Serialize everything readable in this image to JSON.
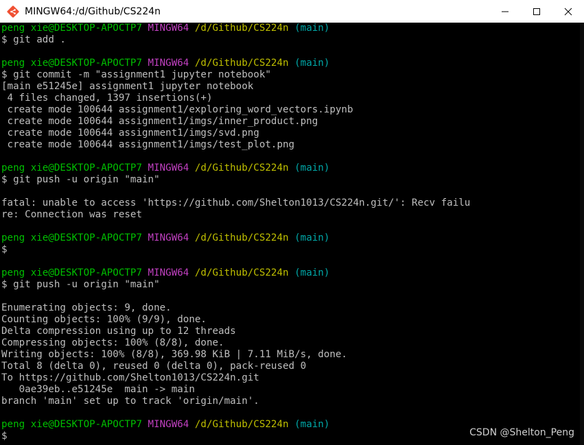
{
  "window": {
    "title": "MINGW64:/d/Github/CS224n",
    "icon": "git-bash-icon",
    "controls": [
      "minimize-icon",
      "maximize-icon",
      "close-icon"
    ]
  },
  "colors": {
    "user": "#00c000",
    "host": "#c040c0",
    "path": "#bfbf00",
    "branch": "#00a8a8",
    "text": "#bfbfbf",
    "background": "#000000"
  },
  "prompt": {
    "user": "peng xie@DESKTOP-APOCTP7",
    "host": "MINGW64",
    "path": "/d/Github/CS224n",
    "branch": "(main)"
  },
  "lines": [
    "",
    "$ git add .",
    "",
    "",
    "$ git commit -m \"assignment1 jupyter notebook\"",
    "[main e51245e] assignment1 jupyter notebook",
    " 4 files changed, 1397 insertions(+)",
    " create mode 100644 assignment1/exploring_word_vectors.ipynb",
    " create mode 100644 assignment1/imgs/inner_product.png",
    " create mode 100644 assignment1/imgs/svd.png",
    " create mode 100644 assignment1/imgs/test_plot.png",
    "",
    "",
    "$ git push -u origin \"main\"",
    "",
    "fatal: unable to access 'https://github.com/Shelton1013/CS224n.git/': Recv failu",
    "re: Connection was reset",
    "",
    "",
    "$",
    "",
    "",
    "$ git push -u origin \"main\"",
    "",
    "Enumerating objects: 9, done.",
    "Counting objects: 100% (9/9), done.",
    "Delta compression using up to 12 threads",
    "Compressing objects: 100% (8/8), done.",
    "Writing objects: 100% (8/8), 369.98 KiB | 7.11 MiB/s, done.",
    "Total 8 (delta 0), reused 0 (delta 0), pack-reused 0",
    "To https://github.com/Shelton1013/CS224n.git",
    "   0ae39eb..e51245e  main -> main",
    "branch 'main' set up to track 'origin/main'.",
    "",
    "",
    "$"
  ],
  "watermark": "CSDN @Shelton_Peng"
}
